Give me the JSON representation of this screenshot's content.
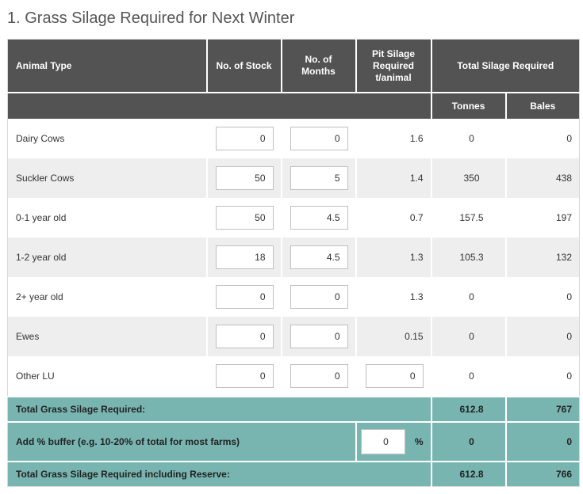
{
  "page": {
    "title": "1. Grass Silage Required for Next Winter"
  },
  "header": {
    "animal_type": "Animal Type",
    "no_of_stock": "No. of Stock",
    "no_of_months": "No. of Months",
    "pit_silage": "Pit Silage Required t/animal",
    "total_silage": "Total Silage Required",
    "tonnes": "Tonnes",
    "bales": "Bales"
  },
  "rows": [
    {
      "label": "Dairy Cows",
      "stock": "0",
      "months": "0",
      "pit": "1.6",
      "tonnes": "0",
      "bales": "0"
    },
    {
      "label": "Suckler Cows",
      "stock": "50",
      "months": "5",
      "pit": "1.4",
      "tonnes": "350",
      "bales": "438"
    },
    {
      "label": "0-1 year old",
      "stock": "50",
      "months": "4.5",
      "pit": "0.7",
      "tonnes": "157.5",
      "bales": "197"
    },
    {
      "label": "1-2 year old",
      "stock": "18",
      "months": "4.5",
      "pit": "1.3",
      "tonnes": "105.3",
      "bales": "132"
    },
    {
      "label": "2+ year old",
      "stock": "0",
      "months": "0",
      "pit": "1.3",
      "tonnes": "0",
      "bales": "0"
    },
    {
      "label": "Ewes",
      "stock": "0",
      "months": "0",
      "pit": "0.15",
      "tonnes": "0",
      "bales": "0"
    },
    {
      "label": "Other LU",
      "stock": "0",
      "months": "0",
      "pit": "0",
      "tonnes": "0",
      "bales": "0"
    }
  ],
  "totals": {
    "required_label": "Total Grass Silage Required:",
    "required_tonnes": "612.8",
    "required_bales": "767",
    "buffer_label": "Add % buffer (e.g. 10-20% of total for most farms)",
    "buffer_value": "0",
    "buffer_unit": "%",
    "buffer_tonnes": "0",
    "buffer_bales": "0",
    "reserve_label": "Total Grass Silage Required including Reserve:",
    "reserve_tonnes": "612.8",
    "reserve_bales": "766"
  },
  "colors": {
    "header_bg": "#535353",
    "total_bg": "#78b5b1",
    "alt_row_bg": "#eeeeee"
  }
}
